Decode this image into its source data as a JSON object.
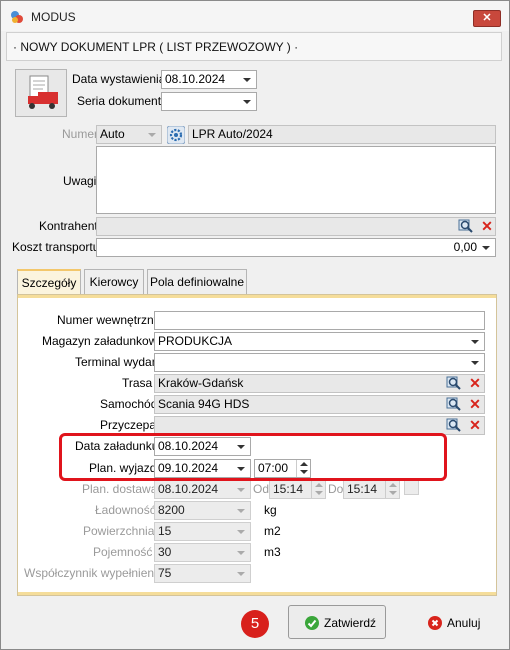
{
  "window": {
    "title": "MODUS",
    "close_label": "✕"
  },
  "header": {
    "title": "· NOWY DOKUMENT LPR ( LIST PRZEWOZOWY ) ·"
  },
  "top": {
    "data_wystawienia_label": "Data wystawienia",
    "data_wystawienia_value": "08.10.2024",
    "seria_label": "Seria dokumentu",
    "seria_value": "",
    "numer_label": "Numer",
    "numer_mode": "Auto",
    "numer_value": "LPR Auto/2024",
    "uwagi_label": "Uwagi",
    "uwagi_value": "",
    "kontrahent_label": "Kontrahent",
    "kontrahent_value": "",
    "koszt_label": "Koszt transportu",
    "koszt_value": "0,00"
  },
  "tabs": [
    {
      "label": "Szczegóły",
      "active": true
    },
    {
      "label": "Kierowcy",
      "active": false
    },
    {
      "label": "Pola definiowalne",
      "active": false
    }
  ],
  "details": {
    "numer_wewnetrzny_label": "Numer wewnętrzny",
    "numer_wewnetrzny_value": "",
    "magazyn_label": "Magazyn załadunkowy",
    "magazyn_value": "PRODUKCJA",
    "terminal_label": "Terminal wydań",
    "terminal_value": "",
    "trasa_label": "Trasa",
    "trasa_value": "Kraków-Gdańsk",
    "samochod_label": "Samochód",
    "samochod_value": "Scania 94G HDS",
    "przyczepa_label": "Przyczepa",
    "przyczepa_value": "",
    "data_zaladunku_label": "Data załadunku",
    "data_zaladunku_value": "08.10.2024",
    "plan_wyjazd_label": "Plan. wyjazd",
    "plan_wyjazd_date": "09.10.2024",
    "plan_wyjazd_time": "07:00",
    "plan_dostawa_label": "Plan. dostawa",
    "plan_dostawa_date": "08.10.2024",
    "plan_dostawa_time": "15:14",
    "od_label": "Od",
    "od_value": "15:14",
    "do_label": "Do",
    "do_value": "15:14",
    "ladownosc_label": "Ładowność",
    "ladownosc_value": "8200",
    "ladownosc_unit": "kg",
    "powierzchnia_label": "Powierzchnia",
    "powierzchnia_value": "15",
    "powierzchnia_unit": "m2",
    "pojemnosc_label": "Pojemność",
    "pojemnosc_value": "30",
    "pojemnosc_unit": "m3",
    "wspolczynnik_label": "Współczynnik wypełnienia",
    "wspolczynnik_value": "75"
  },
  "footer": {
    "step_badge": "5",
    "confirm_label": "Zatwierdź",
    "cancel_label": "Anuluj"
  },
  "colors": {
    "highlight": "#e0141c",
    "tab_accent": "#f3c76b",
    "confirm_icon": "#3aa63a",
    "cancel_icon": "#d8241c"
  }
}
